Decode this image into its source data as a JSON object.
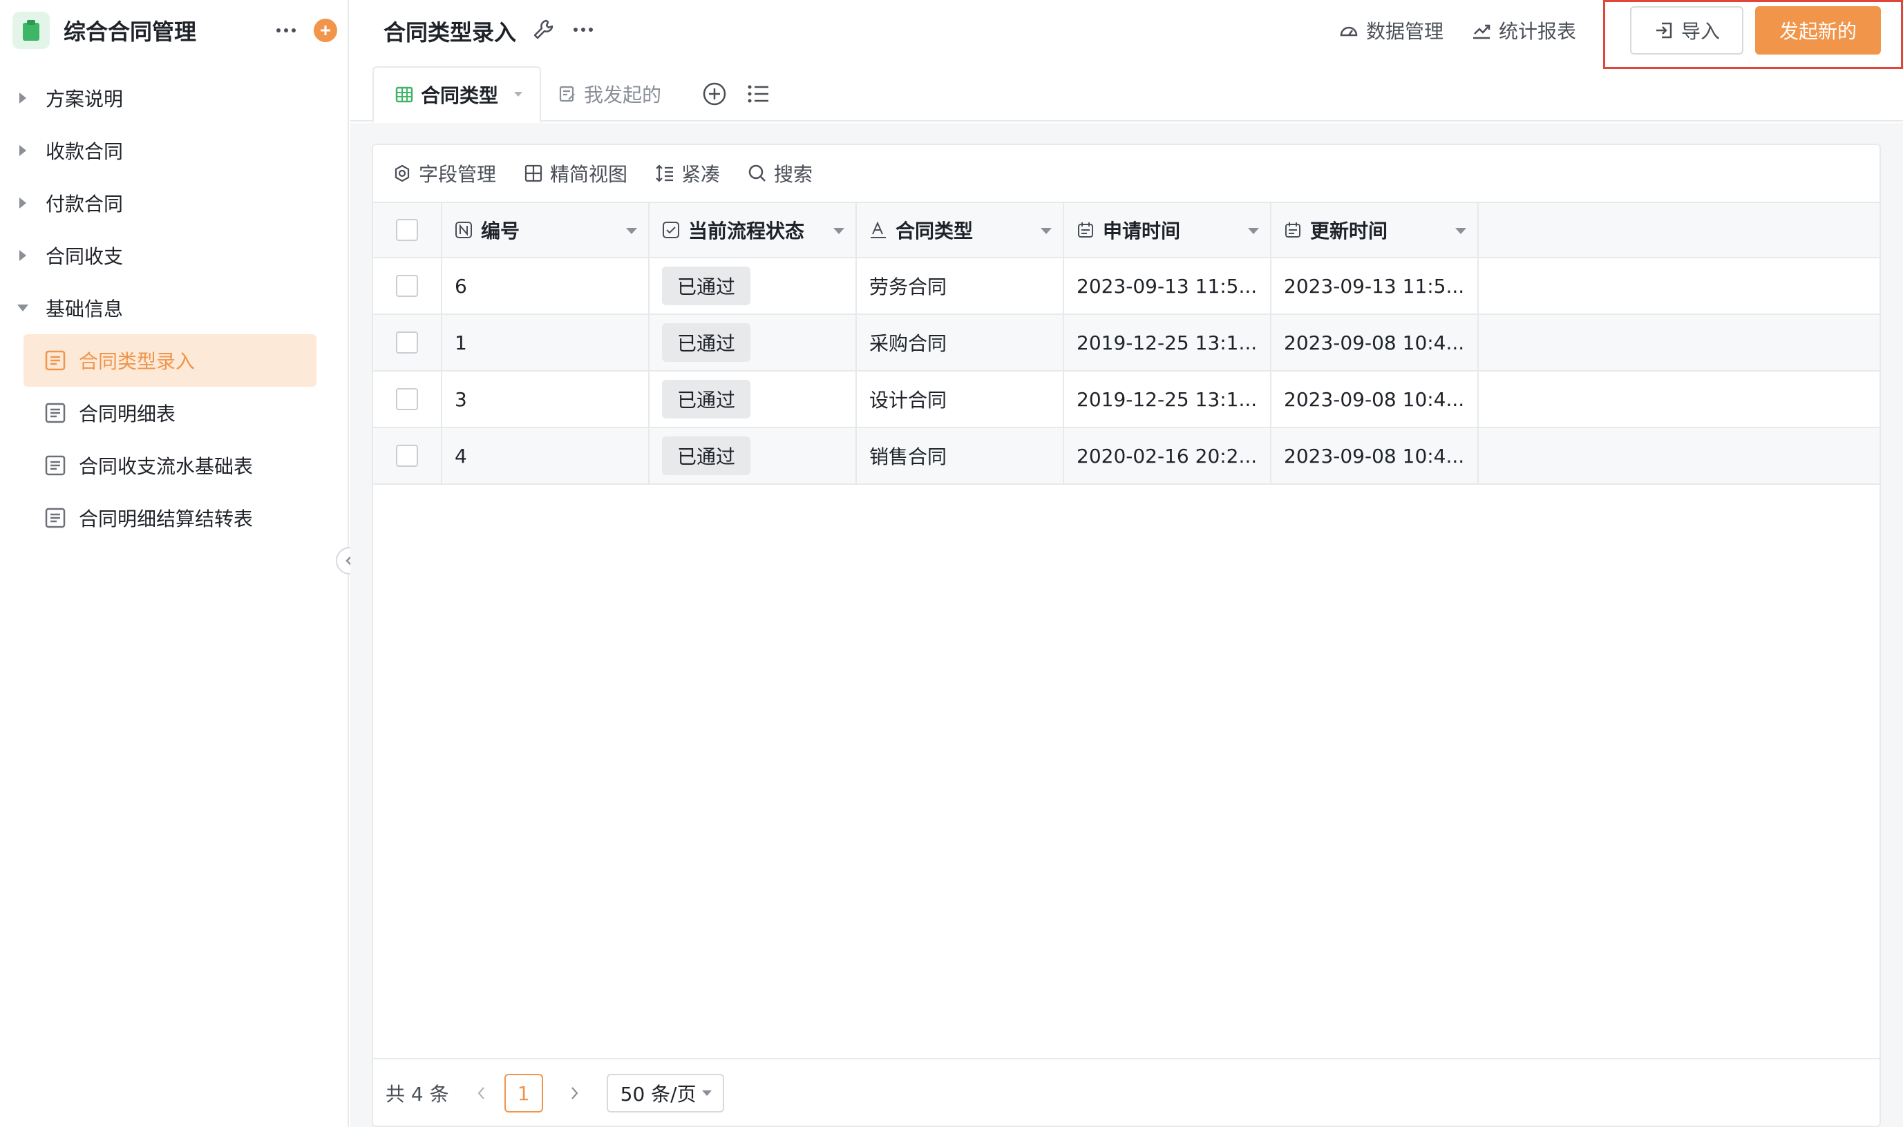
{
  "app": {
    "title": "综合合同管理"
  },
  "sidebar": {
    "groups": [
      {
        "label": "方案说明",
        "expanded": false
      },
      {
        "label": "收款合同",
        "expanded": false
      },
      {
        "label": "付款合同",
        "expanded": false
      },
      {
        "label": "合同收支",
        "expanded": false
      },
      {
        "label": "基础信息",
        "expanded": true
      }
    ],
    "items": [
      {
        "label": "合同类型录入",
        "active": true
      },
      {
        "label": "合同明细表",
        "active": false
      },
      {
        "label": "合同收支流水基础表",
        "active": false
      },
      {
        "label": "合同明细结算结转表",
        "active": false
      }
    ]
  },
  "header": {
    "page_title": "合同类型录入",
    "data_manage": "数据管理",
    "stats_report": "统计报表",
    "import_label": "导入",
    "start_label": "发起新的"
  },
  "tabs": [
    {
      "label": "合同类型",
      "active": true
    },
    {
      "label": "我发起的",
      "active": false
    }
  ],
  "toolbar": {
    "field_manage": "字段管理",
    "simple_view": "精简视图",
    "compact": "紧凑",
    "search": "搜索"
  },
  "table": {
    "columns": [
      "编号",
      "当前流程状态",
      "合同类型",
      "申请时间",
      "更新时间"
    ],
    "rows": [
      {
        "id": "6",
        "status": "已通过",
        "type": "劳务合同",
        "apply": "2023-09-13 11:5...",
        "update": "2023-09-13 11:5..."
      },
      {
        "id": "1",
        "status": "已通过",
        "type": "采购合同",
        "apply": "2019-12-25 13:1...",
        "update": "2023-09-08 10:4..."
      },
      {
        "id": "3",
        "status": "已通过",
        "type": "设计合同",
        "apply": "2019-12-25 13:1...",
        "update": "2023-09-08 10:4..."
      },
      {
        "id": "4",
        "status": "已通过",
        "type": "销售合同",
        "apply": "2020-02-16 20:2...",
        "update": "2023-09-08 10:4..."
      }
    ]
  },
  "pagination": {
    "total": "共 4 条",
    "current_page": "1",
    "page_size": "50 条/页"
  },
  "colors": {
    "accent": "#f0954a",
    "highlight_border": "#e2463a"
  }
}
